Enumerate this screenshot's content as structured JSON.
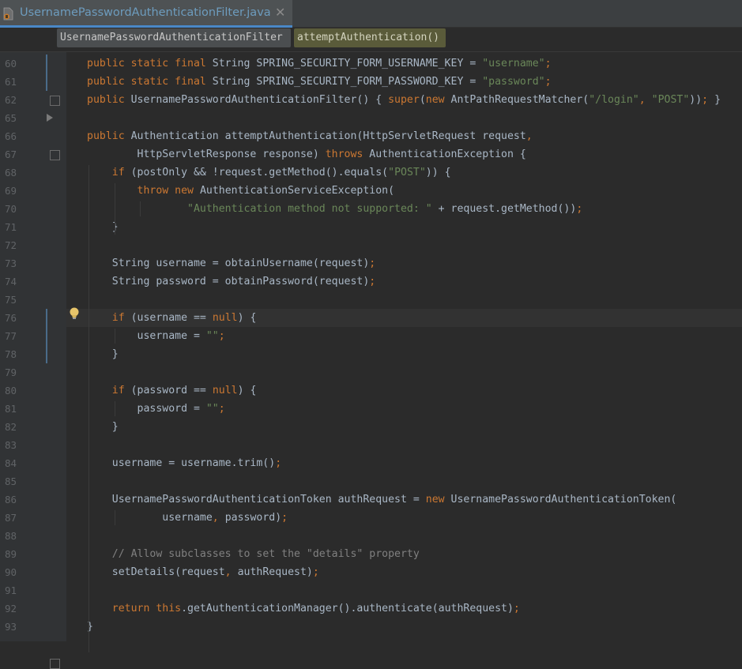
{
  "tab": {
    "filename": "UsernamePasswordAuthenticationFilter.java",
    "icon": "java-class-icon",
    "close_icon": "close-icon",
    "close_glyph": "✕"
  },
  "breadcrumb": {
    "class_name": "UsernamePasswordAuthenticationFilter",
    "method_name": "attemptAuthentication()"
  },
  "colors": {
    "keyword": "#cc7832",
    "string": "#6a8759",
    "comment": "#808080",
    "text": "#a9b7c6",
    "background": "#2b2b2b",
    "line_number": "#606366"
  },
  "gutter": {
    "intention_icon": "lightbulb-icon"
  },
  "code_lines": [
    {
      "num": "60",
      "segments": [
        {
          "t": "public static final",
          "c": "kw"
        },
        {
          "t": " String SPRING_SECURITY_FORM_USERNAME_KEY = "
        },
        {
          "t": "\"username\"",
          "c": "str"
        },
        {
          "t": ";",
          "c": "punc"
        }
      ]
    },
    {
      "num": "61",
      "segments": [
        {
          "t": "public static final",
          "c": "kw"
        },
        {
          "t": " String SPRING_SECURITY_FORM_PASSWORD_KEY = "
        },
        {
          "t": "\"password\"",
          "c": "str"
        },
        {
          "t": ";",
          "c": "punc"
        }
      ]
    },
    {
      "num": "62",
      "segments": [
        {
          "t": "public",
          "c": "kw"
        },
        {
          "t": " UsernamePasswordAuthenticationFilter() { "
        },
        {
          "t": "super",
          "c": "kw"
        },
        {
          "t": "("
        },
        {
          "t": "new",
          "c": "kw"
        },
        {
          "t": " AntPathRequestMatcher("
        },
        {
          "t": "\"/login\"",
          "c": "str"
        },
        {
          "t": ", ",
          "c": "punc"
        },
        {
          "t": "\"POST\"",
          "c": "str"
        },
        {
          "t": "))"
        },
        {
          "t": ";",
          "c": "punc"
        },
        {
          "t": " }"
        }
      ]
    },
    {
      "num": "65",
      "segments": []
    },
    {
      "num": "66",
      "segments": [
        {
          "t": "public",
          "c": "kw"
        },
        {
          "t": " Authentication attemptAuthentication(HttpServletRequest request"
        },
        {
          "t": ",",
          "c": "punc"
        }
      ]
    },
    {
      "num": "67",
      "segments": [
        {
          "t": "        HttpServletResponse response) "
        },
        {
          "t": "throws",
          "c": "kw"
        },
        {
          "t": " AuthenticationException {"
        }
      ]
    },
    {
      "num": "68",
      "segments": [
        {
          "t": "    "
        },
        {
          "t": "if",
          "c": "kw"
        },
        {
          "t": " (postOnly && !request.getMethod().equals("
        },
        {
          "t": "\"POST\"",
          "c": "str"
        },
        {
          "t": ")) {"
        }
      ]
    },
    {
      "num": "69",
      "segments": [
        {
          "t": "        "
        },
        {
          "t": "throw new",
          "c": "kw"
        },
        {
          "t": " AuthenticationServiceException("
        }
      ]
    },
    {
      "num": "70",
      "segments": [
        {
          "t": "                "
        },
        {
          "t": "\"Authentication method not supported: \"",
          "c": "str"
        },
        {
          "t": " + request.getMethod())"
        },
        {
          "t": ";",
          "c": "punc"
        }
      ]
    },
    {
      "num": "71",
      "segments": [
        {
          "t": "    }"
        }
      ]
    },
    {
      "num": "72",
      "segments": []
    },
    {
      "num": "73",
      "segments": [
        {
          "t": "    String username = obtainUsername(request)"
        },
        {
          "t": ";",
          "c": "punc"
        }
      ]
    },
    {
      "num": "74",
      "segments": [
        {
          "t": "    String password = obtainPassword(request)"
        },
        {
          "t": ";",
          "c": "punc"
        }
      ]
    },
    {
      "num": "75",
      "segments": []
    },
    {
      "num": "76",
      "segments": [
        {
          "t": "    "
        },
        {
          "t": "if",
          "c": "kw"
        },
        {
          "t": " (username == "
        },
        {
          "t": "null",
          "c": "kw"
        },
        {
          "t": ") {"
        }
      ]
    },
    {
      "num": "77",
      "segments": [
        {
          "t": "        username = "
        },
        {
          "t": "\"\"",
          "c": "str"
        },
        {
          "t": ";",
          "c": "punc"
        }
      ]
    },
    {
      "num": "78",
      "segments": [
        {
          "t": "    }"
        }
      ]
    },
    {
      "num": "79",
      "segments": []
    },
    {
      "num": "80",
      "segments": [
        {
          "t": "    "
        },
        {
          "t": "if",
          "c": "kw"
        },
        {
          "t": " (password == "
        },
        {
          "t": "null",
          "c": "kw"
        },
        {
          "t": ") {"
        }
      ]
    },
    {
      "num": "81",
      "segments": [
        {
          "t": "        password = "
        },
        {
          "t": "\"\"",
          "c": "str"
        },
        {
          "t": ";",
          "c": "punc"
        }
      ]
    },
    {
      "num": "82",
      "segments": [
        {
          "t": "    }"
        }
      ]
    },
    {
      "num": "83",
      "segments": []
    },
    {
      "num": "84",
      "segments": [
        {
          "t": "    username = username.trim()"
        },
        {
          "t": ";",
          "c": "punc"
        }
      ]
    },
    {
      "num": "85",
      "segments": []
    },
    {
      "num": "86",
      "segments": [
        {
          "t": "    UsernamePasswordAuthenticationToken authRequest = "
        },
        {
          "t": "new",
          "c": "kw"
        },
        {
          "t": " UsernamePasswordAuthenticationToken("
        }
      ]
    },
    {
      "num": "87",
      "segments": [
        {
          "t": "            username"
        },
        {
          "t": ", ",
          "c": "punc"
        },
        {
          "t": "password)"
        },
        {
          "t": ";",
          "c": "punc"
        }
      ]
    },
    {
      "num": "88",
      "segments": []
    },
    {
      "num": "89",
      "segments": [
        {
          "t": "    "
        },
        {
          "t": "// Allow subclasses to set the \"details\" property",
          "c": "cmt"
        }
      ]
    },
    {
      "num": "90",
      "segments": [
        {
          "t": "    setDetails(request"
        },
        {
          "t": ", ",
          "c": "punc"
        },
        {
          "t": "authRequest)"
        },
        {
          "t": ";",
          "c": "punc"
        }
      ]
    },
    {
      "num": "91",
      "segments": []
    },
    {
      "num": "92",
      "segments": [
        {
          "t": "    "
        },
        {
          "t": "return this",
          "c": "kw"
        },
        {
          "t": ".getAuthenticationManager().authenticate(authRequest)"
        },
        {
          "t": ";",
          "c": "punc"
        }
      ]
    },
    {
      "num": "93",
      "segments": [
        {
          "t": "}"
        }
      ]
    }
  ]
}
